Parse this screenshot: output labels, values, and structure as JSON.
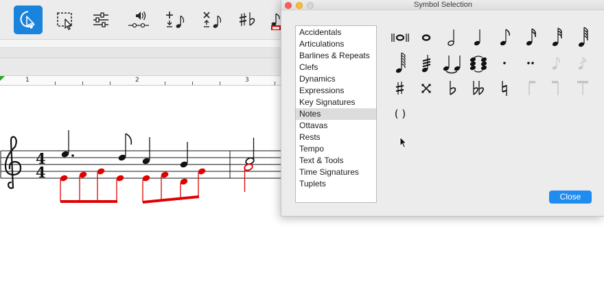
{
  "toolbar": {
    "tools": [
      {
        "name": "select-tool",
        "icon": "pointer-select-icon",
        "active": true
      },
      {
        "name": "marquee-tool",
        "icon": "marquee-select-icon",
        "active": false
      },
      {
        "name": "mixer-tool",
        "icon": "sliders-icon",
        "active": false
      },
      {
        "name": "playback-tool",
        "icon": "speaker-icon",
        "active": false
      },
      {
        "name": "add-note-tool",
        "icon": "add-note-icon",
        "active": false
      },
      {
        "name": "delete-note-tool",
        "icon": "delete-note-icon",
        "active": false
      },
      {
        "name": "accidentals-tool",
        "icon": "sharp-flat-icon",
        "active": false
      },
      {
        "name": "note-color-tool",
        "icon": "colored-note-icon",
        "active": false
      }
    ]
  },
  "ruler": {
    "labels": [
      "1",
      "2",
      "3"
    ]
  },
  "score": {
    "clef": "treble-clef-icon",
    "time_signature": {
      "top": "4",
      "bottom": "4"
    },
    "highlight_color": "#e00000"
  },
  "dialog": {
    "title": "Symbol Selection",
    "categories": [
      "Accidentals",
      "Articulations",
      "Barlines & Repeats",
      "Clefs",
      "Dynamics",
      "Expressions",
      "Key Signatures",
      "Notes",
      "Ottavas",
      "Rests",
      "Tempo",
      "Text & Tools",
      "Time Signatures",
      "Tuplets"
    ],
    "selected_category": "Notes",
    "symbols": [
      {
        "name": "double-whole-note-icon",
        "enabled": true
      },
      {
        "name": "whole-note-icon",
        "enabled": true
      },
      {
        "name": "half-note-icon",
        "enabled": true
      },
      {
        "name": "quarter-note-icon",
        "enabled": true
      },
      {
        "name": "eighth-note-icon",
        "enabled": true
      },
      {
        "name": "sixteenth-note-icon",
        "enabled": true
      },
      {
        "name": "thirty-second-note-icon",
        "enabled": true
      },
      {
        "name": "sixty-fourth-note-icon",
        "enabled": true
      },
      {
        "name": "one-twenty-eighth-note-icon",
        "enabled": true
      },
      {
        "name": "tremolo-note-icon",
        "enabled": true
      },
      {
        "name": "tie-icon",
        "enabled": true
      },
      {
        "name": "tied-chord-icon",
        "enabled": true
      },
      {
        "name": "dot-icon",
        "enabled": true
      },
      {
        "name": "double-dot-icon",
        "enabled": true
      },
      {
        "name": "grace-note-icon",
        "enabled": false
      },
      {
        "name": "grace-note-slash-icon",
        "enabled": false
      },
      {
        "name": "sharp-icon",
        "enabled": true
      },
      {
        "name": "double-sharp-icon",
        "enabled": true
      },
      {
        "name": "flat-icon",
        "enabled": true
      },
      {
        "name": "double-flat-icon",
        "enabled": true
      },
      {
        "name": "natural-icon",
        "enabled": true
      },
      {
        "name": "beam-start-icon",
        "enabled": false
      },
      {
        "name": "beam-end-icon",
        "enabled": false
      },
      {
        "name": "beam-continue-icon",
        "enabled": false
      },
      {
        "name": "parentheses-icon",
        "enabled": true,
        "text": "( )"
      }
    ],
    "close_label": "Close"
  },
  "colors": {
    "accent": "#1a84dc",
    "button": "#1f8cf0"
  }
}
